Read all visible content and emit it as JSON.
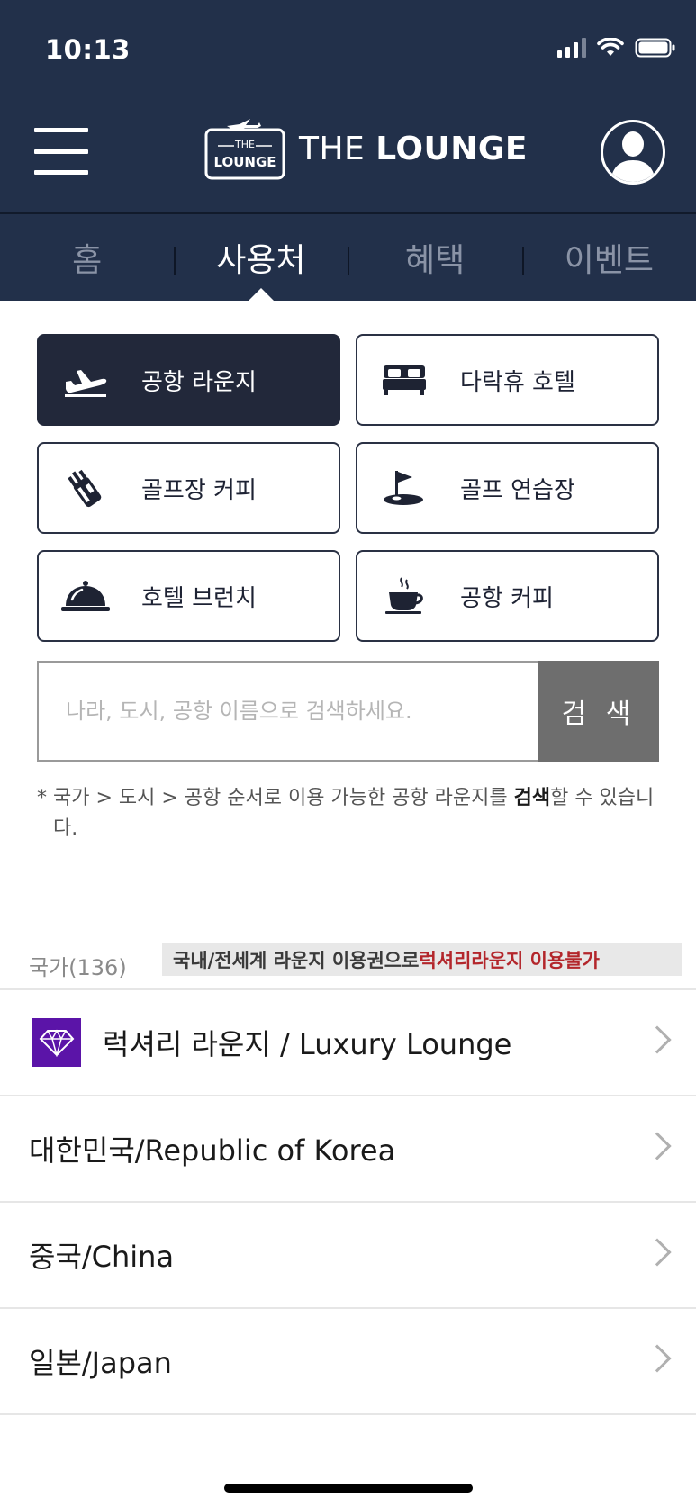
{
  "status_bar": {
    "time": "10:13"
  },
  "header": {
    "brand_badge_top": "THE",
    "brand_badge_bottom": "LOUNGE",
    "brand_name_light": "THE ",
    "brand_name_bold": "LOUNGE"
  },
  "tabs": [
    {
      "label": "홈",
      "active": false
    },
    {
      "label": "사용처",
      "active": true
    },
    {
      "label": "혜택",
      "active": false
    },
    {
      "label": "이벤트",
      "active": false
    }
  ],
  "categories": [
    {
      "label": "공항 라운지",
      "icon": "airplane-icon",
      "active": true
    },
    {
      "label": "다락휴 호텔",
      "icon": "bed-icon",
      "active": false
    },
    {
      "label": "골프장 커피",
      "icon": "golf-bag-icon",
      "active": false
    },
    {
      "label": "골프 연습장",
      "icon": "golf-flag-icon",
      "active": false
    },
    {
      "label": "호텔 브런치",
      "icon": "cloche-icon",
      "active": false
    },
    {
      "label": "공항 커피",
      "icon": "coffee-cup-icon",
      "active": false
    }
  ],
  "search": {
    "placeholder": "나라, 도시, 공항 이름으로 검색하세요.",
    "button_label": "검 색"
  },
  "note": {
    "star": "*",
    "text_before": "국가 > 도시 > 공항 순서로 이용 가능한 공항 라운지를 ",
    "text_bold": "검색",
    "text_after": "할 수 있습니다."
  },
  "country_count_label": "국가(136)",
  "notice": {
    "text": "국내/전세계 라운지 이용권으로 ",
    "highlight": "럭셔리라운지 이용불가",
    "highlight_color": "#b3262b"
  },
  "countries": [
    {
      "label": "럭셔리 라운지 / Luxury Lounge",
      "icon": "diamond-icon"
    },
    {
      "label": "대한민국/Republic of Korea"
    },
    {
      "label": "중국/China"
    },
    {
      "label": "일본/Japan"
    }
  ],
  "colors": {
    "header_bg": "#22304a",
    "active_category_bg": "#22283a",
    "search_button_bg": "#6e6e6e",
    "luxury_badge": "#5b14a8"
  }
}
